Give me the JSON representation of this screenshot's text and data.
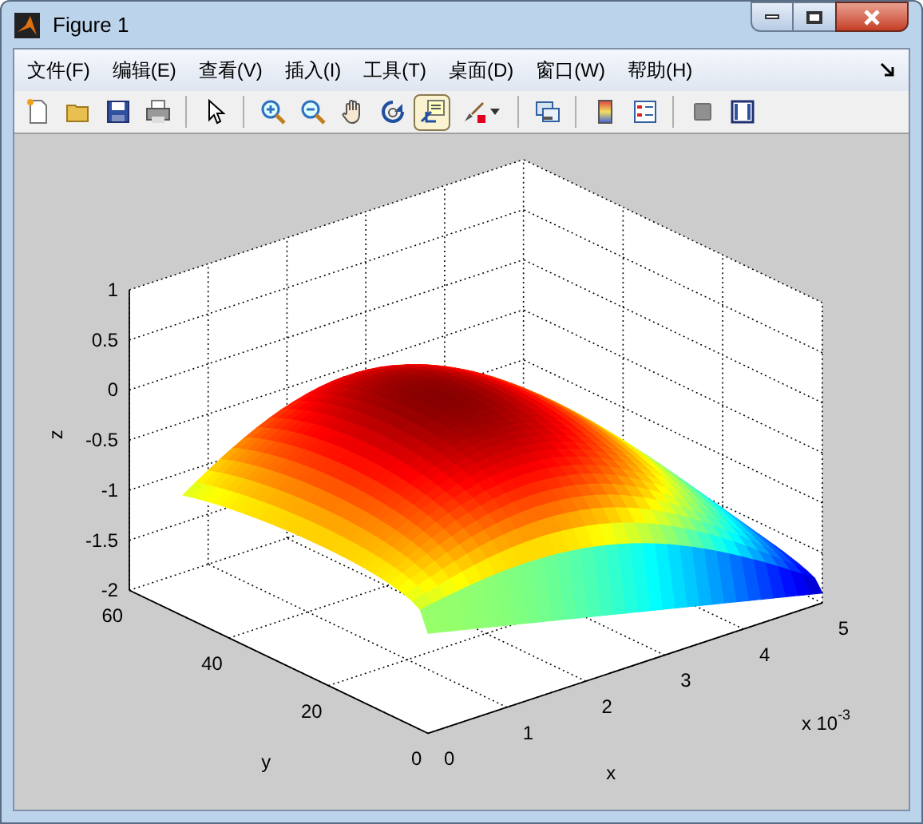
{
  "window": {
    "title": "Figure 1"
  },
  "menu": [
    "文件(F)",
    "编辑(E)",
    "查看(V)",
    "插入(I)",
    "工具(T)",
    "桌面(D)",
    "窗口(W)",
    "帮助(H)"
  ],
  "toolbar": [
    {
      "kind": "button",
      "pressed": false
    },
    {
      "kind": "button",
      "pressed": false
    },
    {
      "kind": "button",
      "pressed": false
    },
    {
      "kind": "button",
      "pressed": false
    },
    {
      "kind": "separator"
    },
    {
      "kind": "button",
      "pressed": false
    },
    {
      "kind": "separator"
    },
    {
      "kind": "button",
      "pressed": false
    },
    {
      "kind": "button",
      "pressed": false
    },
    {
      "kind": "button",
      "pressed": false
    },
    {
      "kind": "button",
      "pressed": false
    },
    {
      "kind": "button",
      "pressed": true
    },
    {
      "kind": "button",
      "pressed": false
    },
    {
      "kind": "separator"
    },
    {
      "kind": "button",
      "pressed": false
    },
    {
      "kind": "separator"
    },
    {
      "kind": "button",
      "pressed": false
    },
    {
      "kind": "button",
      "pressed": false
    },
    {
      "kind": "separator"
    },
    {
      "kind": "button",
      "pressed": false
    },
    {
      "kind": "button",
      "pressed": false
    }
  ],
  "plot": {
    "xlabel": "x",
    "ylabel": "y",
    "zlabel": "z",
    "xticks": [
      "0",
      "1",
      "2",
      "3",
      "4",
      "5"
    ],
    "yticks": [
      "0",
      "20",
      "40",
      "60"
    ],
    "zticks": [
      "1",
      "0.5",
      "0",
      "-0.5",
      "-1",
      "-1.5",
      "-2"
    ],
    "x_multiplier": "x 10",
    "x_exponent": "-3"
  }
}
